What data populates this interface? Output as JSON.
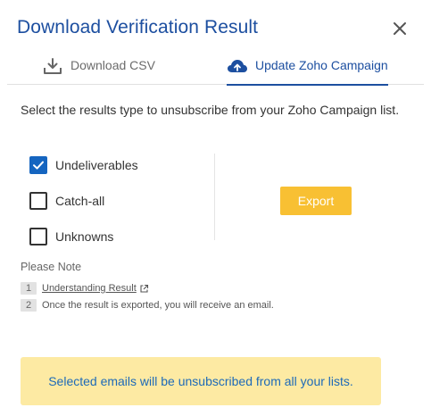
{
  "dialog": {
    "title": "Download Verification Result",
    "close_icon": "close-icon"
  },
  "tabs": [
    {
      "label": "Download CSV",
      "icon": "download-icon",
      "active": false
    },
    {
      "label": "Update Zoho Campaign",
      "icon": "cloud-upload-icon",
      "active": true
    }
  ],
  "intro": "Select the results type to unsubscribe from your Zoho Campaign list.",
  "options": [
    {
      "label": "Undeliverables",
      "checked": true
    },
    {
      "label": "Catch-all",
      "checked": false
    },
    {
      "label": "Unknowns",
      "checked": false
    }
  ],
  "export_button": "Export",
  "note": {
    "title": "Please Note",
    "items": [
      {
        "num": "1",
        "text": "Understanding Result",
        "icon": "external-link-icon"
      },
      {
        "num": "2",
        "text": "Once the result is exported, you will receive an email."
      }
    ]
  },
  "banner": "Selected emails will be unsubscribed from all your lists.",
  "colors": {
    "accent": "#1d4fa0",
    "checkbox": "#1565c0",
    "export_button": "#f8c033",
    "banner_bg": "#fdeaa3",
    "banner_text": "#1d6ab8"
  }
}
